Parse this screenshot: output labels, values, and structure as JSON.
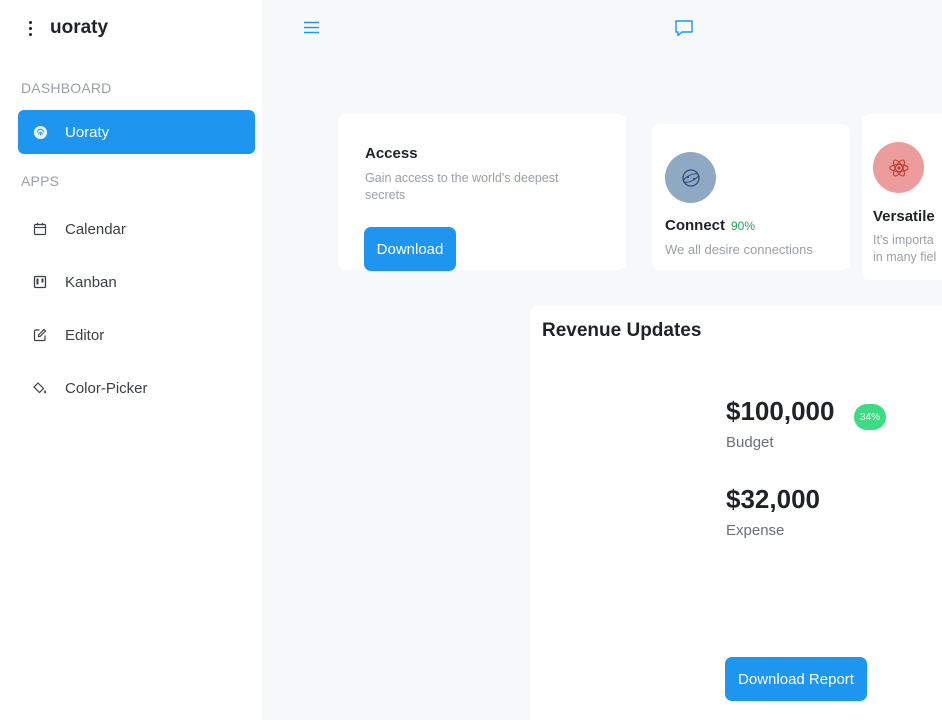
{
  "sidebar": {
    "brand": "uoraty",
    "sections": {
      "dashboard": "DASHBOARD",
      "apps": "APPS"
    },
    "dashboard_items": [
      {
        "label": "Uoraty",
        "icon": "fingerprint-icon"
      }
    ],
    "app_items": [
      {
        "label": "Calendar",
        "icon": "calendar-icon"
      },
      {
        "label": "Kanban",
        "icon": "kanban-icon"
      },
      {
        "label": "Editor",
        "icon": "edit-icon"
      },
      {
        "label": "Color-Picker",
        "icon": "paint-bucket-icon"
      }
    ]
  },
  "topbar": {
    "icons": [
      "menu-icon",
      "chat-icon"
    ]
  },
  "cards": {
    "access": {
      "title": "Access",
      "subtitle": "Gain access to the world's deepest secrets",
      "button": "Download"
    },
    "connect": {
      "title": "Connect",
      "percent": "90%",
      "subtitle": "We all desire connections",
      "icon": "globe-icon"
    },
    "versatile": {
      "title": "Versatile",
      "subtitle": "It's importa in many fiel",
      "icon": "atom-icon"
    }
  },
  "revenue": {
    "title": "Revenue Updates",
    "budget_value": "$100,000",
    "budget_badge": "34%",
    "budget_label": "Budget",
    "expense_value": "$32,000",
    "expense_label": "Expense",
    "button": "Download Report"
  },
  "colors": {
    "accent": "#1e96f0",
    "success": "#3ddc84",
    "connect_circle": "#8fa8c4",
    "versatile_circle": "#ec9c9c"
  }
}
